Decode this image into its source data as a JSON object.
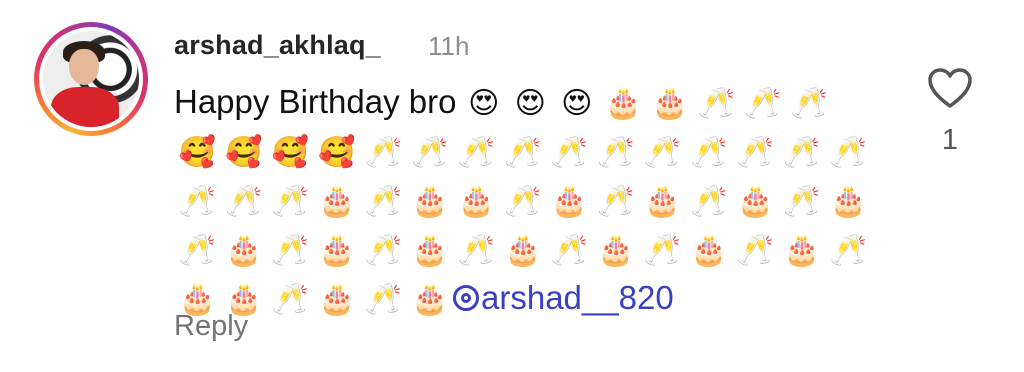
{
  "comment": {
    "username": "arshad_akhlaq_",
    "timestamp": "11h",
    "text": "Happy Birthday bro",
    "emoji_line": [
      "😍",
      "😍",
      "😍",
      "🎂",
      "🎂",
      "🥂",
      "🥂",
      "🥂",
      "🥰",
      "🥰",
      "🥰",
      "🥰",
      "🥂",
      "🥂",
      "🥂",
      "🥂",
      "🥂",
      "🥂",
      "🥂",
      "🥂",
      "🥂",
      "🥂",
      "🥂",
      "🥂",
      "🥂",
      "🥂",
      "🎂",
      "🥂",
      "🎂",
      "🎂",
      "🥂",
      "🎂",
      "🥂",
      "🎂",
      "🥂",
      "🎂",
      "🥂",
      "🎂",
      "🥂",
      "🎂",
      "🥂",
      "🎂",
      "🥂",
      "🎂",
      "🥂",
      "🎂",
      "🥂",
      "🎂",
      "🥂",
      "🎂",
      "🥂",
      "🎂",
      "🥂",
      "🎂",
      "🎂",
      "🥂",
      "🎂",
      "🥂",
      "🎂"
    ],
    "mention": "arshad__820",
    "reply_label": "Reply",
    "like_count": "1"
  },
  "icons": {
    "like": "heart-outline-icon",
    "mention": "threads-at-icon"
  },
  "colors": {
    "mention": "#3a3fc4",
    "secondary_text": "#8e8e8e",
    "ring": "#e1306c"
  }
}
